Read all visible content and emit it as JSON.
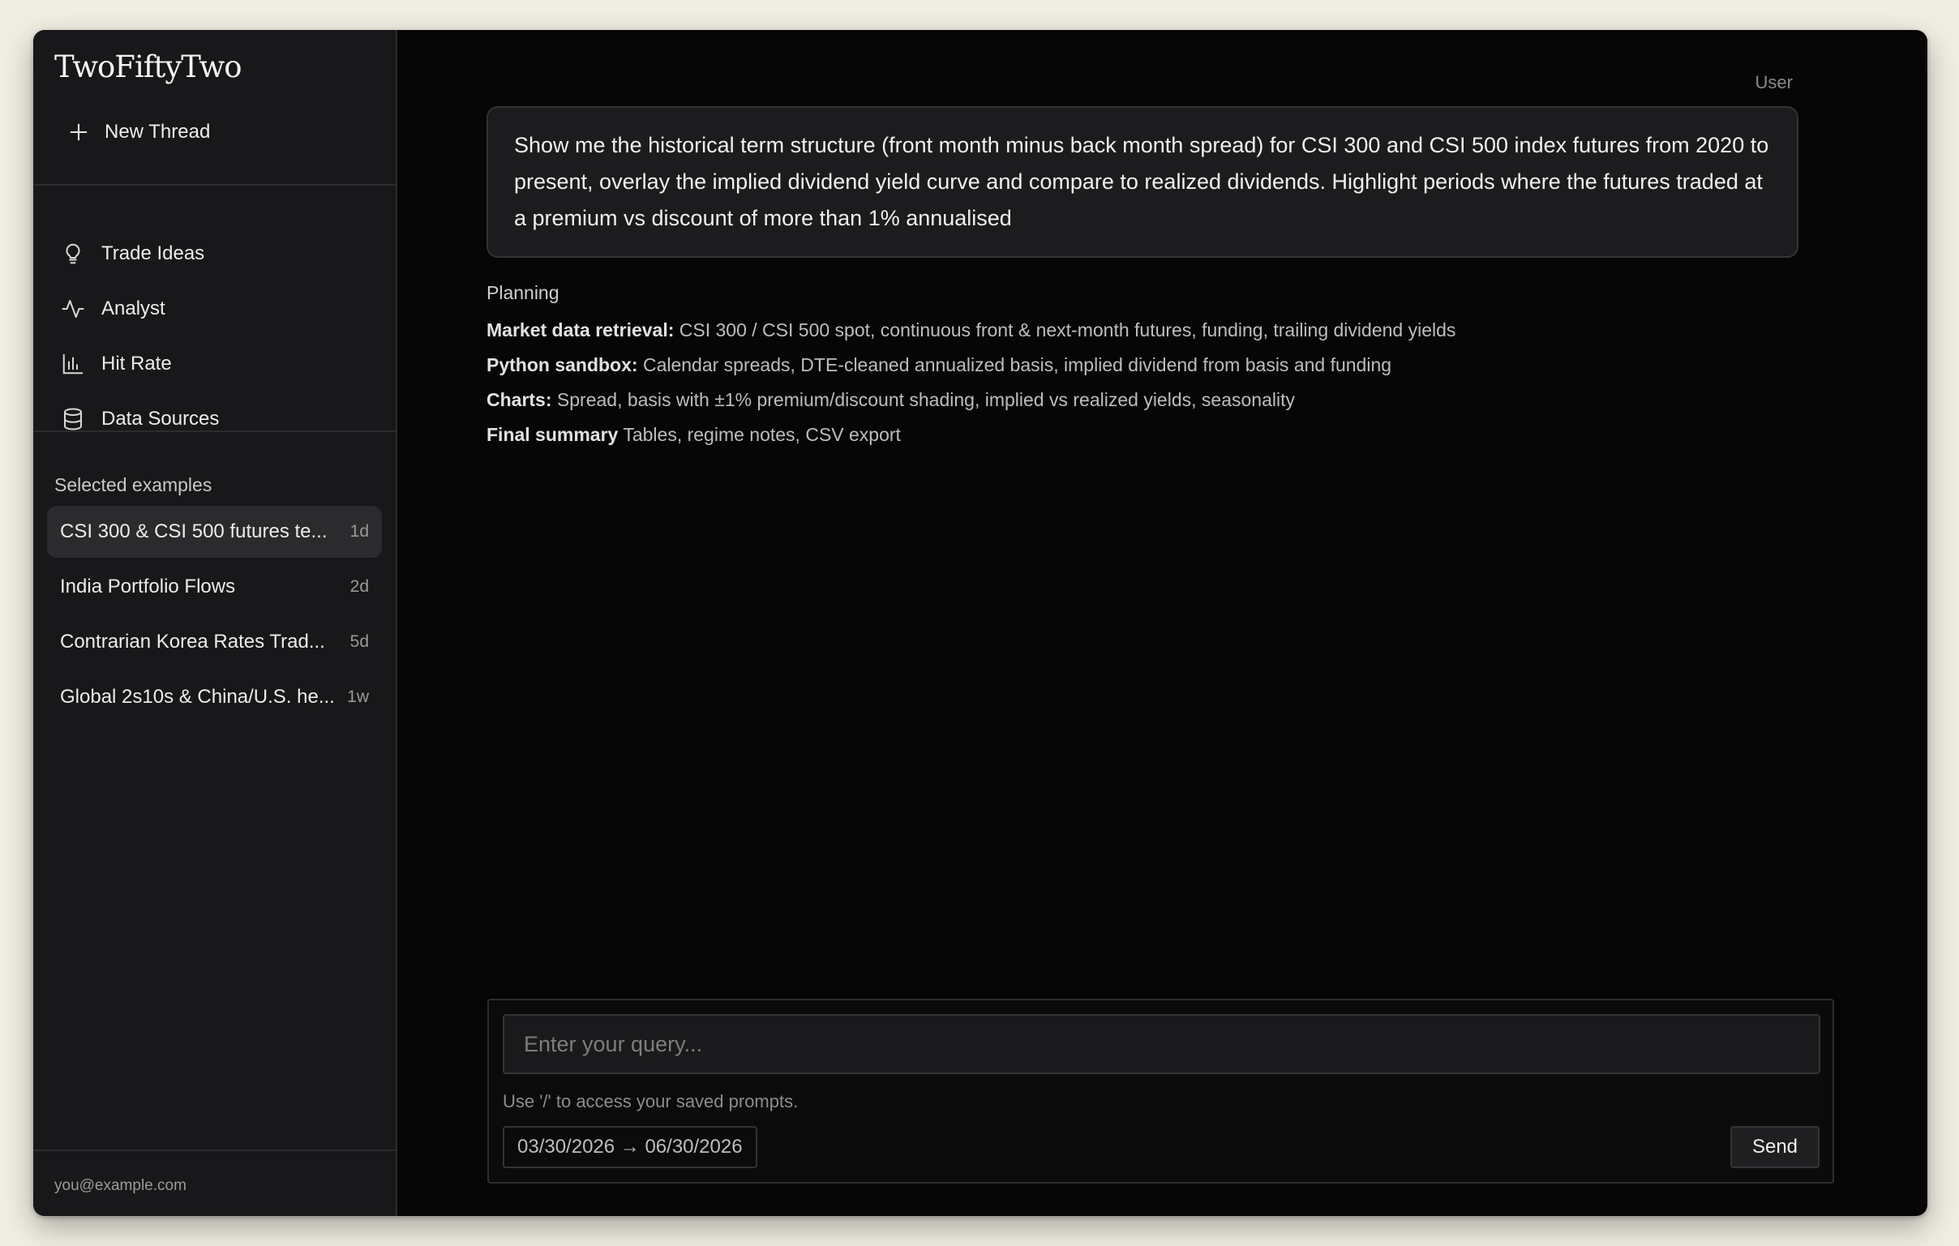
{
  "app": {
    "brand": "TwoFiftyTwo"
  },
  "sidebar": {
    "new_thread": "New Thread",
    "nav": [
      {
        "label": "Trade Ideas",
        "icon": "lightbulb-icon"
      },
      {
        "label": "Analyst",
        "icon": "activity-icon"
      },
      {
        "label": "Hit Rate",
        "icon": "bar-chart-icon"
      },
      {
        "label": "Data Sources",
        "icon": "database-icon"
      }
    ],
    "examples_title": "Selected examples",
    "examples": [
      {
        "title": "CSI 300 & CSI 500 futures te...",
        "age": "1d",
        "active": true
      },
      {
        "title": "India Portfolio Flows",
        "age": "2d",
        "active": false
      },
      {
        "title": "Contrarian Korea Rates Trad...",
        "age": "5d",
        "active": false
      },
      {
        "title": "Global 2s10s & China/U.S. he...",
        "age": "1w",
        "active": false
      }
    ],
    "user_email": "you@example.com"
  },
  "thread": {
    "user_label": "User",
    "user_message": "Show me the historical term structure (front month minus back month spread) for CSI 300 and CSI 500 index futures from 2020 to present, overlay the implied dividend yield curve and compare to realized dividends. Highlight periods where the futures traded at a premium vs discount of more than 1% annualised",
    "planning": {
      "title": "Planning",
      "steps": [
        {
          "label": "Market data retrieval:",
          "text": "CSI 300 / CSI 500 spot, continuous front & next-month futures, funding, trailing dividend yields"
        },
        {
          "label": "Python sandbox:",
          "text": "Calendar spreads, DTE-cleaned annualized basis, implied dividend from basis and funding"
        },
        {
          "label": "Charts:",
          "text": "Spread, basis with ±1% premium/discount shading, implied vs realized yields, seasonality"
        },
        {
          "label": "Final summary",
          "text": "Tables, regime notes, CSV export"
        }
      ]
    }
  },
  "composer": {
    "value": "",
    "placeholder": "Enter your query...",
    "hint": "Use '/' to access your saved prompts.",
    "date_range": "03/30/2026 → 06/30/2026",
    "send_label": "Send"
  }
}
